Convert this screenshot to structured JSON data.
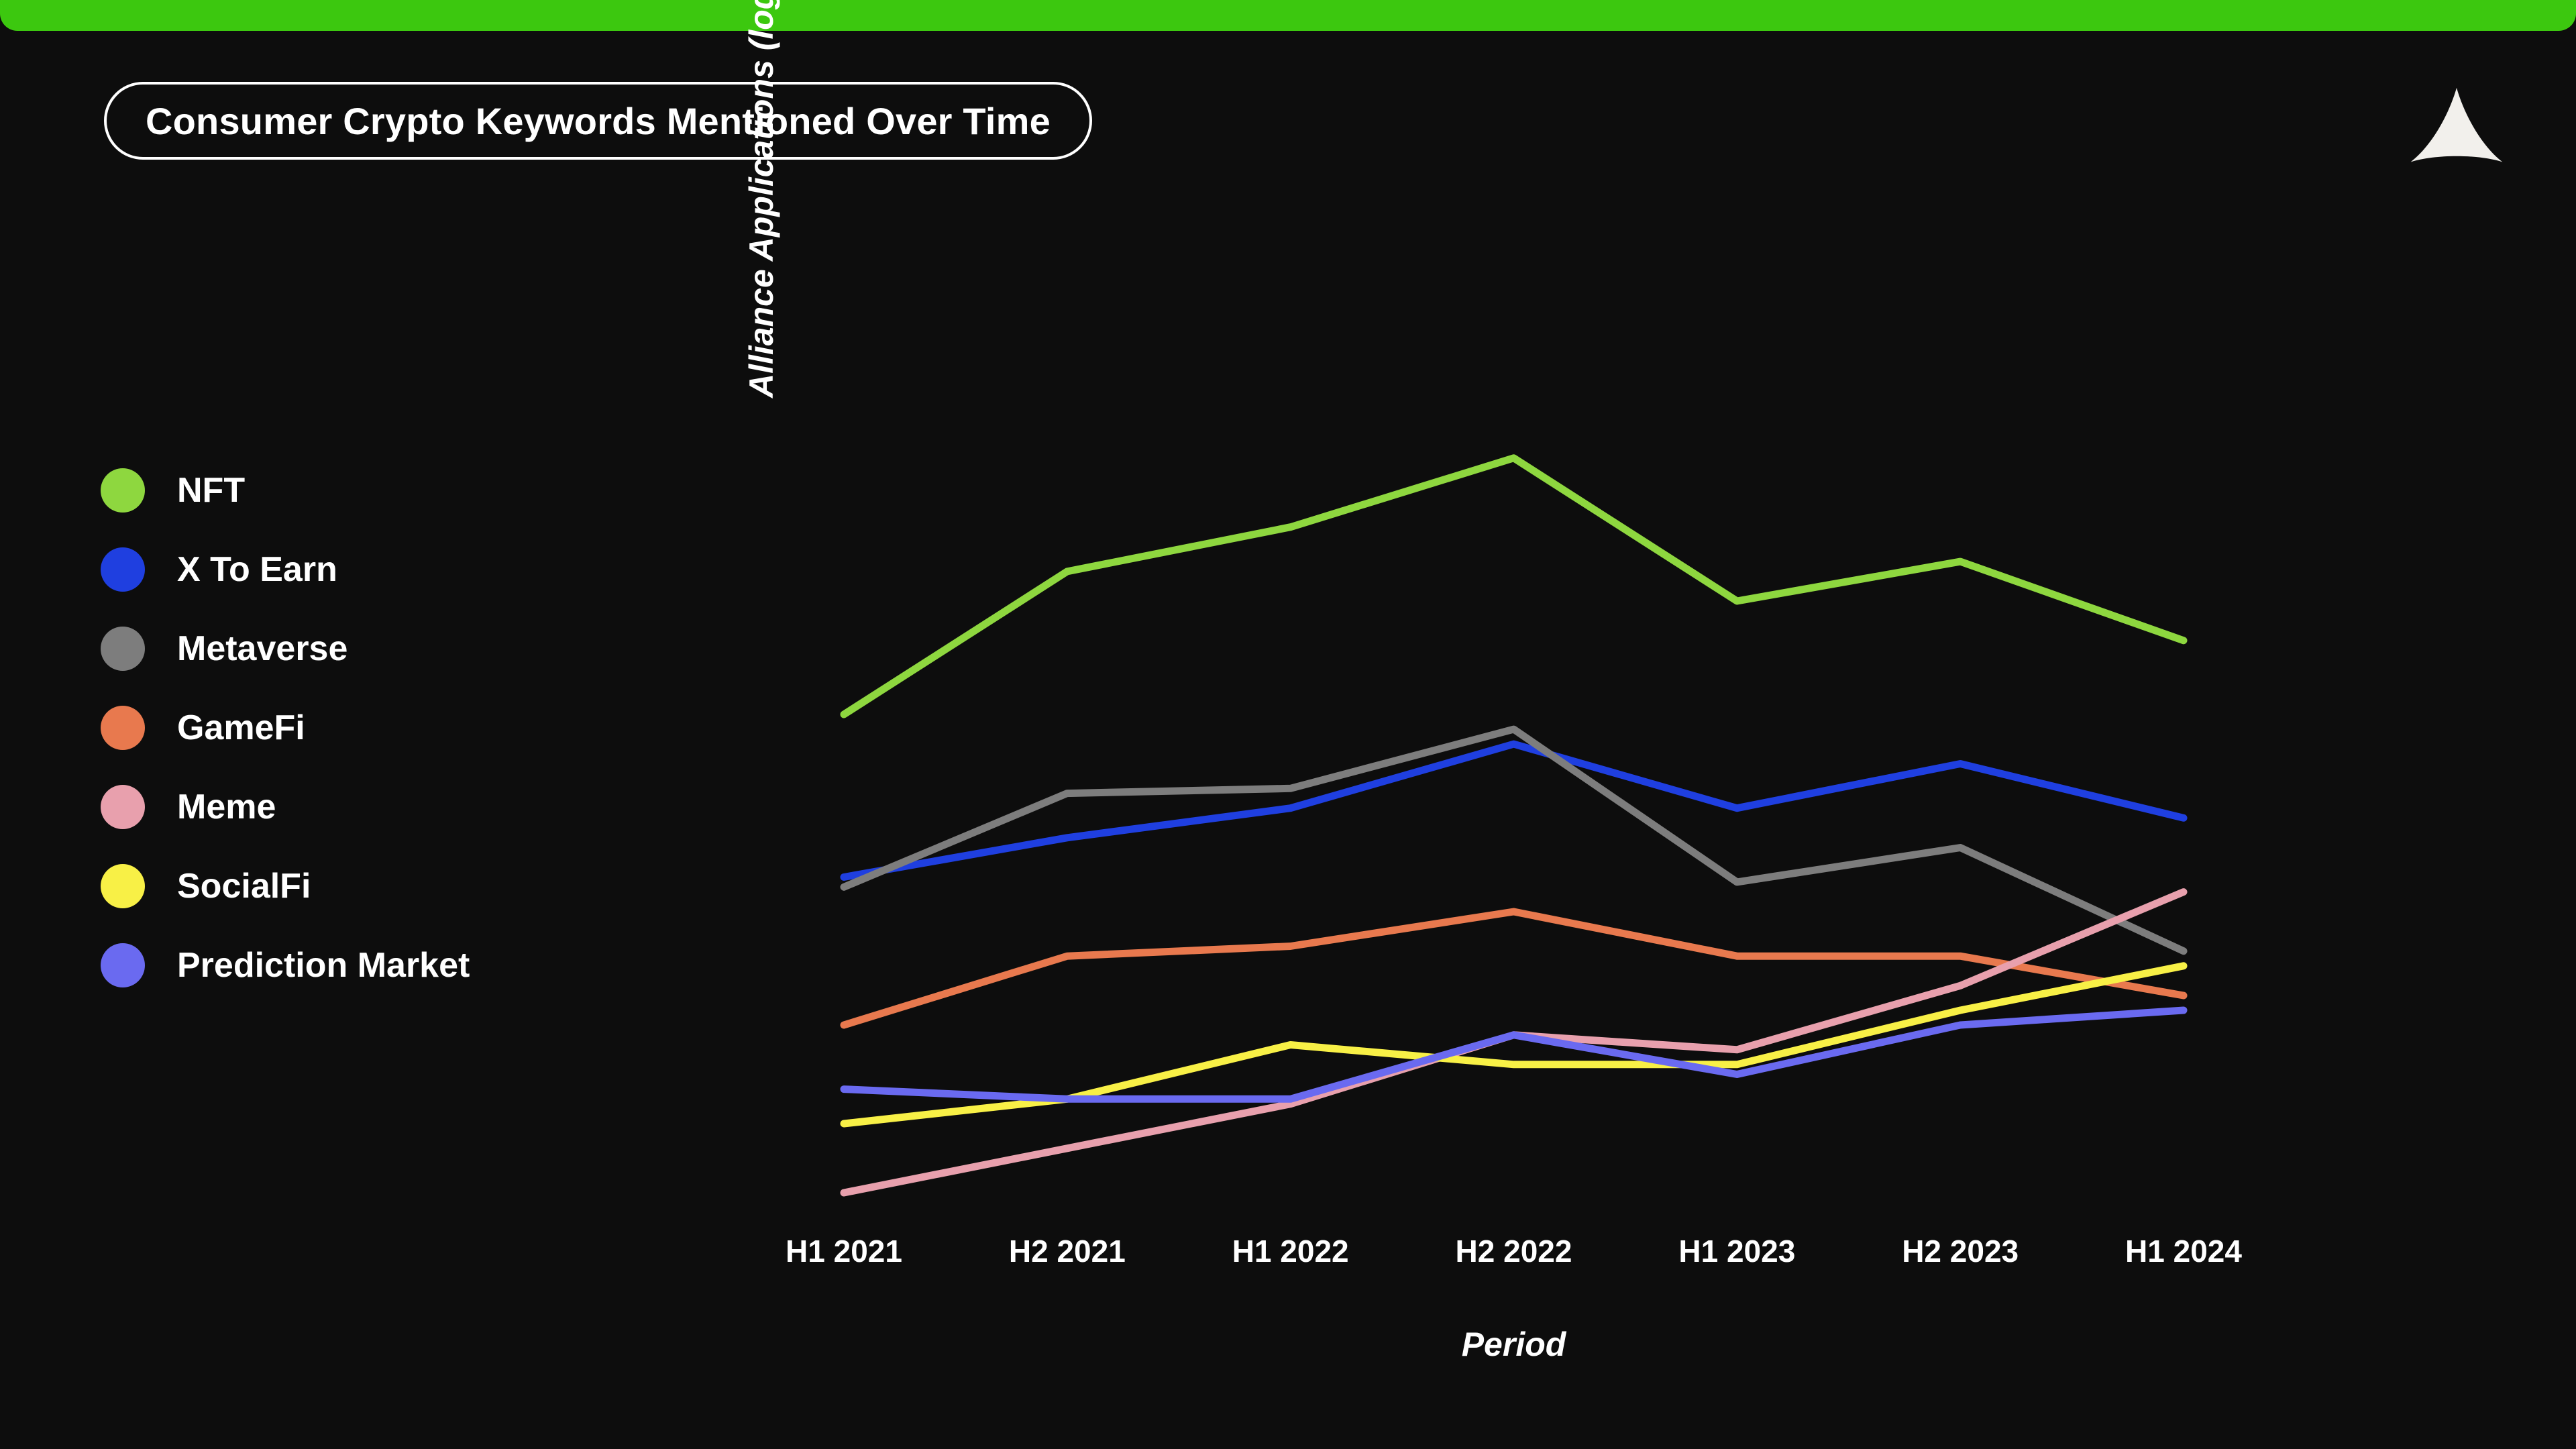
{
  "theme": {
    "background": "#0d0d0d",
    "accent_bar": "#3cc80f",
    "text": "#ffffff"
  },
  "header": {
    "title": "Consumer Crypto Keywords Mentioned Over Time",
    "logo_name": "alliance-logo"
  },
  "legend": {
    "position": "left",
    "items": [
      {
        "label": "NFT",
        "color": "#8ed73f"
      },
      {
        "label": "X To Earn",
        "color": "#1f3fe0"
      },
      {
        "label": "Metaverse",
        "color": "#7d7d7d"
      },
      {
        "label": "GameFi",
        "color": "#e8794e"
      },
      {
        "label": "Meme",
        "color": "#e8a0ad"
      },
      {
        "label": "SocialFi",
        "color": "#f8f046"
      },
      {
        "label": "Prediction Market",
        "color": "#6a6af0"
      }
    ]
  },
  "chart_data": {
    "type": "line",
    "title": "Consumer Crypto Keywords Mentioned Over Time",
    "xlabel": "Period",
    "ylabel": "Alliance Applications (log)",
    "grid": false,
    "legend_position": "left",
    "y_scale": "log",
    "y_axis_ticks_shown": false,
    "categories": [
      "H1 2021",
      "H2 2021",
      "H1 2022",
      "H2 2022",
      "H1 2023",
      "H2 2023",
      "H1 2024"
    ],
    "ylim": [
      0,
      100
    ],
    "series": [
      {
        "name": "NFT",
        "color": "#8ed73f",
        "values": [
          50.0,
          64.5,
          69.0,
          76.0,
          61.5,
          65.5,
          57.5
        ]
      },
      {
        "name": "X To Earn",
        "color": "#1f3fe0",
        "values": [
          33.5,
          37.5,
          40.5,
          47.0,
          40.5,
          45.0,
          39.5
        ]
      },
      {
        "name": "Metaverse",
        "color": "#7d7d7d",
        "values": [
          32.5,
          42.0,
          42.5,
          48.5,
          33.0,
          36.5,
          26.0
        ]
      },
      {
        "name": "GameFi",
        "color": "#e8794e",
        "values": [
          18.5,
          25.5,
          26.5,
          30.0,
          25.5,
          25.5,
          21.5
        ]
      },
      {
        "name": "Meme",
        "color": "#e8a0ad",
        "values": [
          1.5,
          6.0,
          10.5,
          17.5,
          16.0,
          22.5,
          32.0
        ]
      },
      {
        "name": "SocialFi",
        "color": "#f8f046",
        "values": [
          8.5,
          11.0,
          16.5,
          14.5,
          14.5,
          20.0,
          24.5
        ]
      },
      {
        "name": "Prediction Market",
        "color": "#6a6af0",
        "values": [
          12.0,
          11.0,
          11.0,
          17.5,
          13.5,
          18.5,
          20.0
        ]
      }
    ]
  },
  "axes": {
    "x_tick_labels": [
      "H1 2021",
      "H2 2021",
      "H1 2022",
      "H2 2022",
      "H1 2023",
      "H2 2023",
      "H1 2024"
    ]
  }
}
